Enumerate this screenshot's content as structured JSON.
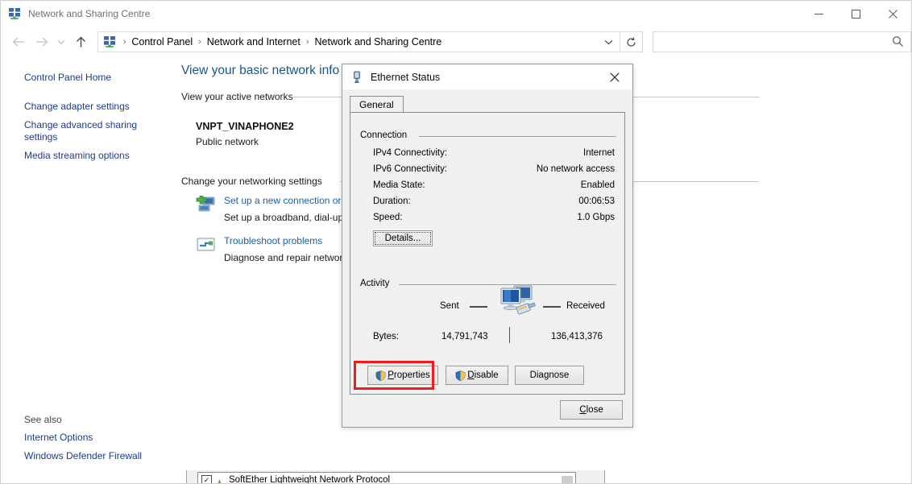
{
  "window": {
    "title": "Network and Sharing Centre",
    "icon": "network-icon",
    "controls": {
      "minimize": "minimize-icon",
      "maximize": "maximize-icon",
      "close": "close-icon"
    }
  },
  "nav": {
    "back": "back-arrow-icon",
    "forward": "forward-arrow-icon",
    "history": "chevron-down-icon",
    "up": "up-arrow-icon",
    "refresh": "refresh-icon",
    "breadcrumbs": [
      {
        "label": "Control Panel"
      },
      {
        "label": "Network and Internet"
      },
      {
        "label": "Network and Sharing Centre"
      }
    ],
    "separator": "›",
    "dropdown": "chevron-down-icon"
  },
  "search": {
    "value": "",
    "placeholder": "",
    "icon": "search-icon"
  },
  "sidebar": {
    "items": [
      {
        "label": "Control Panel Home"
      },
      {
        "label": "Change adapter settings"
      },
      {
        "label": "Change advanced sharing settings"
      },
      {
        "label": "Media streaming options"
      }
    ],
    "see_also_heading": "See also",
    "see_also": [
      {
        "label": "Internet Options"
      },
      {
        "label": "Windows Defender Firewall"
      }
    ]
  },
  "content": {
    "page_title": "View your basic network info",
    "active_networks_heading": "View your active networks",
    "network": {
      "name": "VNPT_VINAPHONE2",
      "type": "Public network"
    },
    "change_settings_heading": "Change your networking settings",
    "tasks": [
      {
        "icon": "new-connection-icon",
        "link": "Set up a new connection or",
        "desc": "Set up a broadband, dial-up"
      },
      {
        "icon": "troubleshoot-icon",
        "link": "Troubleshoot problems",
        "desc": "Diagnose and repair networ"
      }
    ]
  },
  "bottom_strip": {
    "checkbox_checked": true,
    "icon": "protocol-icon",
    "label": "SoftEther Lightweight Network Protocol"
  },
  "dialog": {
    "title": "Ethernet Status",
    "icon": "ethernet-plug-icon",
    "close_icon": "close-icon",
    "tabs": [
      {
        "label": "General",
        "active": true
      }
    ],
    "connection": {
      "group_label": "Connection",
      "rows": [
        {
          "key": "IPv4 Connectivity:",
          "value": "Internet"
        },
        {
          "key": "IPv6 Connectivity:",
          "value": "No network access"
        },
        {
          "key": "Media State:",
          "value": "Enabled"
        },
        {
          "key": "Duration:",
          "value": "00:06:53"
        },
        {
          "key": "Speed:",
          "value": "1.0 Gbps"
        }
      ],
      "details_button": "Details..."
    },
    "activity": {
      "group_label": "Activity",
      "sent_label": "Sent",
      "received_label": "Received",
      "icon": "two-computers-network-icon",
      "bytes_label": "Bytes:",
      "bytes_sent": "14,791,743",
      "bytes_received": "136,413,376"
    },
    "buttons": {
      "properties": "Properties",
      "disable": "Disable",
      "diagnose": "Diagnose",
      "close": "Close"
    },
    "highlight": {
      "target": "properties-button",
      "color": "#ee1c1c"
    }
  }
}
